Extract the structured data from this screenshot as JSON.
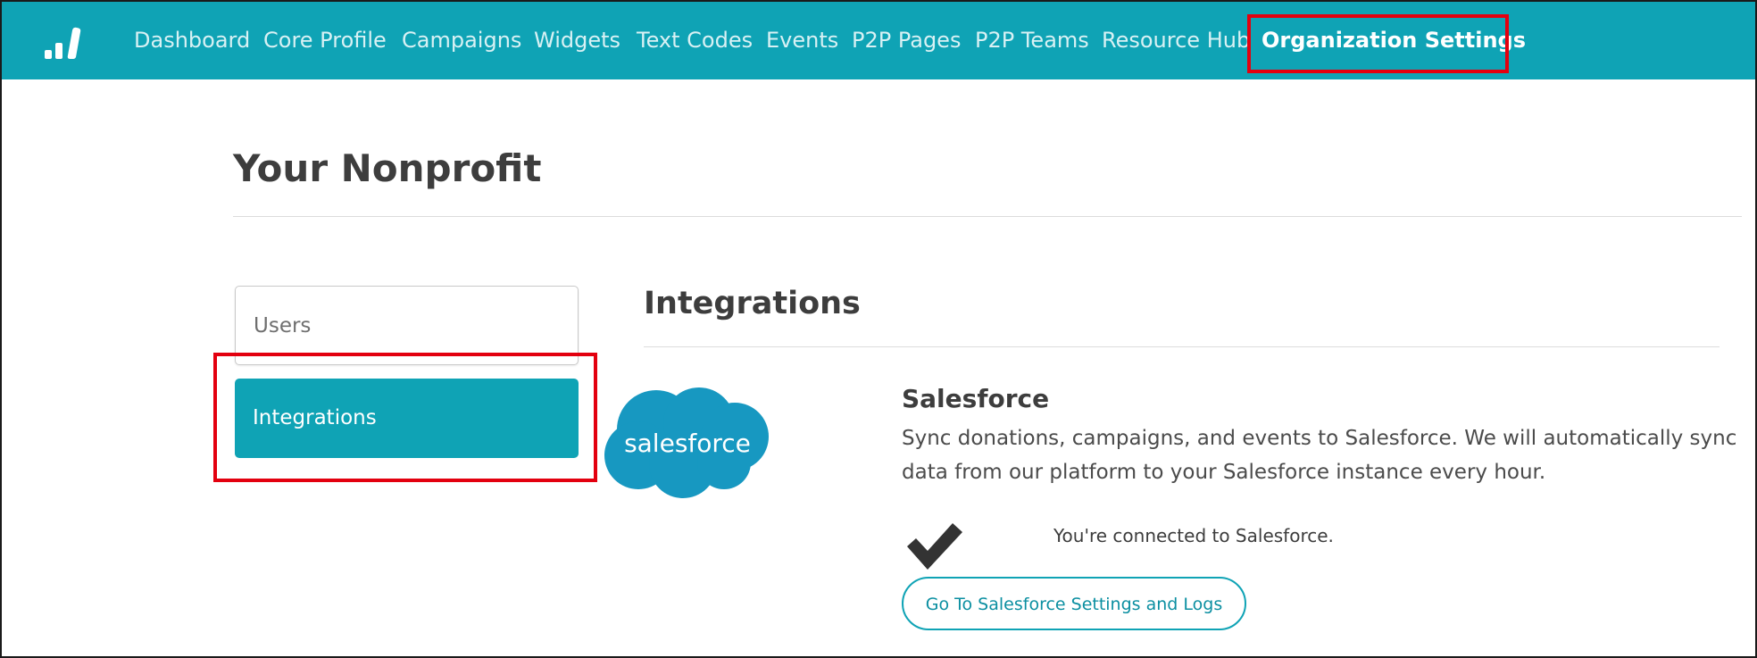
{
  "colors": {
    "nav_background": "#0fa3b5",
    "nav_text": "#d8f1f4",
    "nav_active_text": "#ffffff",
    "sidebar_active_background": "#0fa3b5",
    "annotation_highlight": "#e3000f",
    "salesforce_blue": "#1798c1"
  },
  "nav": {
    "logo_icon": "bar-chart-logo-icon",
    "items": [
      {
        "label": "Dashboard",
        "active": false
      },
      {
        "label": "Core Profile",
        "active": false
      },
      {
        "label": "Campaigns",
        "active": false
      },
      {
        "label": "Widgets",
        "active": false
      },
      {
        "label": "Text Codes",
        "active": false
      },
      {
        "label": "Events",
        "active": false
      },
      {
        "label": "P2P Pages",
        "active": false
      },
      {
        "label": "P2P Teams",
        "active": false
      },
      {
        "label": "Resource Hub",
        "active": false
      },
      {
        "label": "Organization Settings",
        "active": true
      }
    ]
  },
  "page": {
    "title": "Your Nonprofit"
  },
  "sidebar": {
    "items": [
      {
        "label": "Users",
        "active": false
      },
      {
        "label": "Integrations",
        "active": true
      }
    ]
  },
  "main": {
    "section_title": "Integrations",
    "integration": {
      "logo_text": "salesforce",
      "logo_icon": "salesforce-cloud-logo",
      "name": "Salesforce",
      "description": "Sync donations, campaigns, and events to Salesforce. We will automatically sync data from our platform to your Salesforce instance every hour.",
      "status_icon": "checkmark-icon",
      "status_text": "You're connected to Salesforce.",
      "button_label": "Go To Salesforce Settings and Logs"
    }
  }
}
